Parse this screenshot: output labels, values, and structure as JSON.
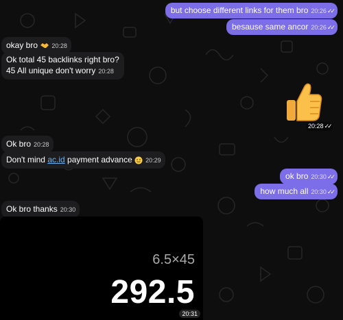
{
  "messages": [
    {
      "text": "but choose different links for them bro",
      "time": "20:26",
      "dir": "out"
    },
    {
      "text": "besause same ancor",
      "time": "20:26",
      "dir": "out"
    },
    {
      "text": "okay bro",
      "time": "20:28",
      "dir": "in",
      "emoji": "handshake"
    },
    {
      "line1": "Ok total 45 backlinks right bro?",
      "line2": "45 All unique don't worry",
      "time": "20:28",
      "dir": "in"
    },
    {
      "sticker": "thumbs-up",
      "time": "20:28",
      "dir": "out"
    },
    {
      "text": "Ok bro",
      "time": "20:28",
      "dir": "in"
    },
    {
      "pre": "Don't mind ",
      "link": "ac.id",
      "post": " payment advance",
      "emoji": "smile",
      "time": "20:29",
      "dir": "in"
    },
    {
      "text": "ok bro",
      "time": "20:30",
      "dir": "out"
    },
    {
      "text": "how much all",
      "time": "20:30",
      "dir": "out"
    },
    {
      "text": "Ok bro thanks",
      "time": "20:30",
      "dir": "in"
    }
  ],
  "calculator_media": {
    "expression": "6.5×45",
    "result": "292.5",
    "time": "20:31"
  },
  "read_checks": "✓✓",
  "colors": {
    "outgoing": "#7b6ee8",
    "incoming": "#1d1d1f",
    "link": "#6ab3f3"
  }
}
